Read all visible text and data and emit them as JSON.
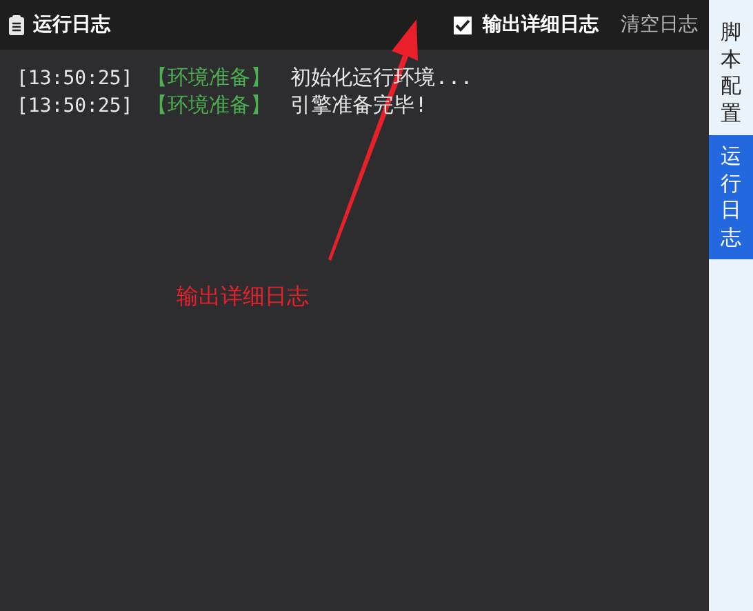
{
  "header": {
    "title": "运行日志",
    "verbose": {
      "label": "输出详细日志",
      "checked": true
    },
    "clear_button": "清空日志"
  },
  "log": [
    {
      "time": "[13:50:25]",
      "tag": "【环境准备】",
      "message": "初始化运行环境..."
    },
    {
      "time": "[13:50:25]",
      "tag": "【环境准备】",
      "message": "引擎准备完毕!"
    }
  ],
  "annotation": {
    "label": "输出详细日志"
  },
  "side_tabs": [
    {
      "label": "脚本配置",
      "selected": false
    },
    {
      "label": "运行日志",
      "selected": true
    }
  ]
}
